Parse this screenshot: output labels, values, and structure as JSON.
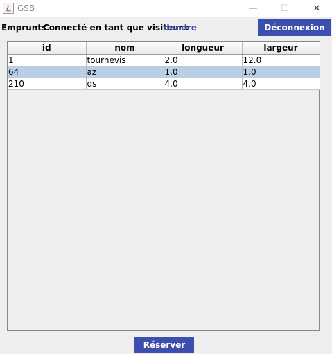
{
  "window": {
    "title": "GSB",
    "minimize_glyph": "—",
    "maximize_glyph": "☐",
    "close_glyph": "✕"
  },
  "header": {
    "section": "Emprunts",
    "connected_label": "Connecté en tant que visiteur :",
    "username": "dandre",
    "logout_label": "Déconnexion"
  },
  "table": {
    "columns": [
      "id",
      "nom",
      "longueur",
      "largeur"
    ],
    "rows": [
      [
        "1",
        "tournevis",
        "2.0",
        "12.0"
      ],
      [
        "64",
        "az",
        "1.0",
        "1.0"
      ],
      [
        "210",
        "ds",
        "4.0",
        "4.0"
      ]
    ],
    "selected_row_index": 1
  },
  "footer": {
    "reserve_label": "Réserver"
  },
  "colors": {
    "accent": "#3d4fae",
    "selection": "#b8cfe5"
  }
}
